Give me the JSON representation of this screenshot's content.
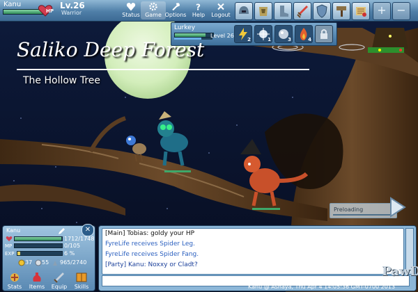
{
  "player": {
    "name": "Kanu",
    "level_label": "Lv.26",
    "class": "Warrior",
    "hp_tag": "HP",
    "hp_fraction": 0.97
  },
  "nav": [
    {
      "label": "Status",
      "icon": "heart-icon"
    },
    {
      "label": "Game",
      "icon": "gear-icon"
    },
    {
      "label": "Options",
      "icon": "wrench-icon"
    },
    {
      "label": "Help",
      "icon": "question-icon"
    },
    {
      "label": "Logout",
      "icon": "close-icon"
    }
  ],
  "toolbar_slots": [
    "helmet-icon",
    "armor-icon",
    "boot-icon",
    "sword-icon",
    "shield-icon",
    "hammer-icon",
    "scroll-icon"
  ],
  "toolbar_extra": [
    "+",
    "−"
  ],
  "monster": {
    "name": "Lurkey",
    "level": "Level 26",
    "hp_fraction": 0.8,
    "mp_fraction": 0.7,
    "skills": [
      {
        "icon": "lightning-icon",
        "count": "2"
      },
      {
        "icon": "sparkle-icon",
        "count": "1"
      },
      {
        "icon": "orb-icon",
        "count": "3"
      },
      {
        "icon": "fire-icon",
        "count": "4"
      },
      {
        "icon": "lock-icon",
        "count": ""
      }
    ]
  },
  "area": {
    "title": "Saliko Deep Forest",
    "subtitle": "The Hollow Tree"
  },
  "preload": {
    "label": "Preloading",
    "fraction": 0.05
  },
  "stats": {
    "name": "Kanu",
    "hp_label": "HP",
    "hp_value": "1712/1748",
    "hp_fraction": 0.98,
    "mp_label": "MP",
    "mp_value": "0/105",
    "mp_fraction": 0.0,
    "exp_label": "EXP",
    "exp_value": "6 %",
    "exp_fraction": 0.06,
    "gold": "37",
    "silver": "55",
    "percent_icon_value": "6",
    "weight": "965/2740",
    "buttons": [
      "Stats",
      "Items",
      "Equip",
      "Skills"
    ]
  },
  "chat": {
    "lines": [
      {
        "text": "[Main] Tobias: goldy your HP",
        "color": "#101010"
      },
      {
        "text": "FyreLife receives Spider Leg.",
        "color": "#2a5fbf"
      },
      {
        "text": "FyreLife receives Spider Fang.",
        "color": "#2a5fbf"
      },
      {
        "text": "[Party] Kanu: Noxxy or Cladt?",
        "color": "#1a3f9a"
      }
    ],
    "input_value": ""
  },
  "footer": "Kanu @ Ashaya, Thu Apr 4 14:05:36 GMT-0700 2013",
  "logo": "PawD",
  "colors": {
    "ui_blue": "#4f7fa8",
    "sky": "#0d1833",
    "moon": "#d7f0c2",
    "bark": "#5a3d22"
  }
}
